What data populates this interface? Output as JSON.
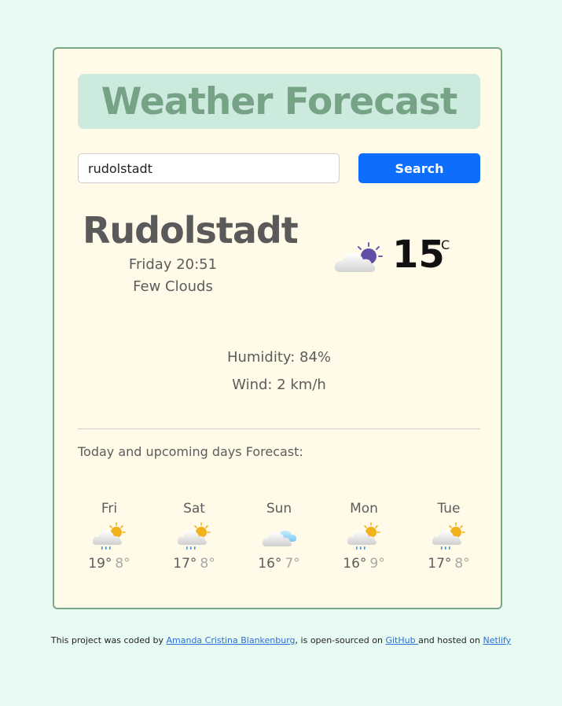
{
  "header": {
    "title": "Weather Forecast"
  },
  "search": {
    "value": "rudolstadt",
    "button_label": "Search"
  },
  "current": {
    "city": "Rudolstadt",
    "datetime": "Friday 20:51",
    "description": "Few Clouds",
    "icon": "few-clouds-night-icon",
    "temperature": "15",
    "unit": "°C",
    "humidity": "Humidity: 84%",
    "wind": "Wind: 2 km/h"
  },
  "forecast": {
    "title": "Today and upcoming days Forecast:",
    "days": [
      {
        "day": "Fri",
        "icon": "rain-sun-icon",
        "max": "19°",
        "min": "8°"
      },
      {
        "day": "Sat",
        "icon": "rain-sun-icon",
        "max": "17°",
        "min": "8°"
      },
      {
        "day": "Sun",
        "icon": "cloudy-icon",
        "max": "16°",
        "min": "7°"
      },
      {
        "day": "Mon",
        "icon": "rain-sun-icon",
        "max": "16°",
        "min": "9°"
      },
      {
        "day": "Tue",
        "icon": "rain-sun-icon",
        "max": "17°",
        "min": "8°"
      }
    ]
  },
  "footer": {
    "text_1": "This project was coded by ",
    "author_link": "Amanda Cristina Blankenburg",
    "text_2": ", is open-sourced on ",
    "github_link": "GitHub ",
    "text_3": "and hosted on ",
    "netlify_link": "Netlify"
  },
  "colors": {
    "background": "#e8fbf3",
    "card": "#fffbe8",
    "title": "#76a386",
    "accent": "#0d6efd"
  }
}
